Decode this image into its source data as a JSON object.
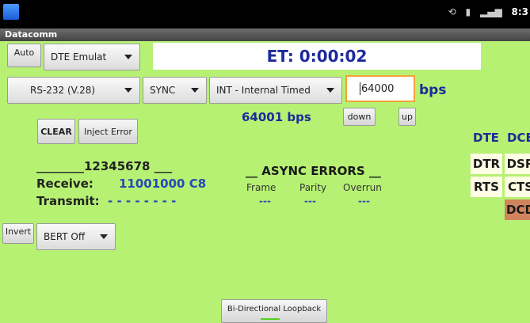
{
  "status_bar": {
    "time": "8:3",
    "icons": [
      "sync-icon",
      "storage-icon",
      "signal-icon"
    ]
  },
  "app": {
    "title": "Datacomm"
  },
  "controls": {
    "auto_label": "Auto",
    "mode_dropdown": "DTE Emulat",
    "interface_dropdown": "RS-232 (V.28)",
    "sync_dropdown": "SYNC",
    "clock_dropdown": "INT - Internal Timed",
    "bps_value": "64000",
    "bps_unit": "bps",
    "measured_rate": "64001 bps",
    "down_label": "down",
    "up_label": "up",
    "clear_label": "CLEAR",
    "inject_error_label": "Inject Error",
    "invert_label": "Invert",
    "bert_dropdown": "BERT Off",
    "loopback_label": "Bi-Directional Loopback"
  },
  "timer": {
    "elapsed": "ET: 0:00:02"
  },
  "data_panel": {
    "pattern_header": "________12345678 ___",
    "receive_label": "Receive:",
    "receive_value": "11001000 C8",
    "transmit_label": "Transmit:",
    "transmit_value": "- - - - - - - -"
  },
  "async_errors": {
    "title": "__ ASYNC ERRORS __",
    "columns": [
      "Frame",
      "Parity",
      "Overrun"
    ],
    "values": [
      "---",
      "---",
      "---"
    ]
  },
  "signals": {
    "dte_header": "DTE",
    "dce_header": "DCE",
    "dtr": "DTR",
    "dsr": "DSR",
    "rts": "RTS",
    "cts": "CTS",
    "dcd": "DCD"
  }
}
